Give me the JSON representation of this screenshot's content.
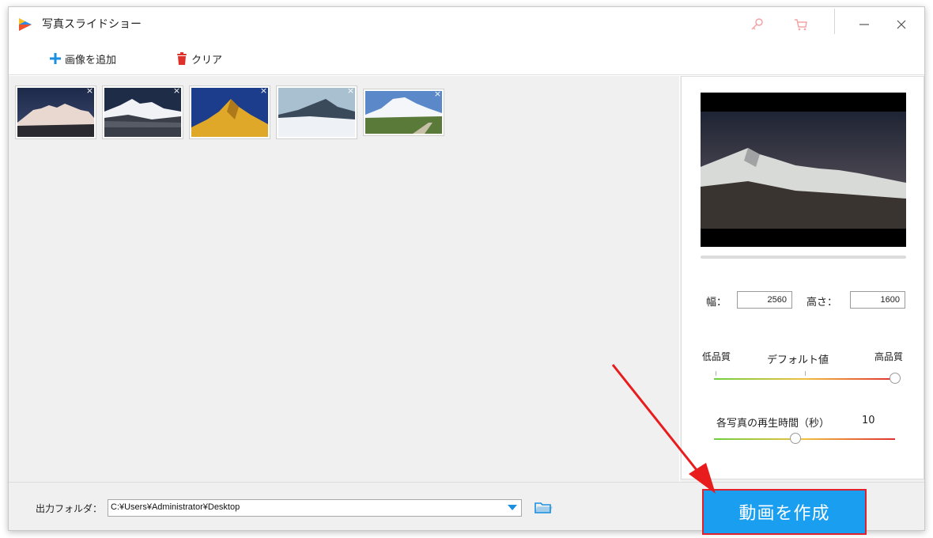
{
  "window": {
    "title": "写真スライドショー"
  },
  "titlebar": {
    "icons": [
      "key-icon",
      "cart-icon",
      "minimize-icon",
      "close-icon"
    ]
  },
  "toolbar": {
    "add_label": "画像を追加",
    "clear_label": "クリア"
  },
  "images": [
    {
      "name": "snowy-ridge-night",
      "close": "×"
    },
    {
      "name": "snow-peak-clouds",
      "close": "×"
    },
    {
      "name": "golden-peak",
      "close": "×"
    },
    {
      "name": "snow-valley",
      "close": "×"
    },
    {
      "name": "snow-mountain-road",
      "close": "×"
    }
  ],
  "settings": {
    "width_label": "幅：",
    "width_value": "2560",
    "height_label": "高さ：",
    "height_value": "1600",
    "quality_low": "低品質",
    "quality_default": "デフォルト値",
    "quality_high": "高品質",
    "quality_level": 1.0,
    "duration_label": "各写真の再生時間（秒）",
    "duration_value": "10",
    "duration_level": 0.45
  },
  "output": {
    "label": "出力フォルダ：",
    "path": "C:¥Users¥Administrator¥Desktop"
  },
  "create_button": "動画を作成",
  "colors": {
    "accent": "#1a9ff0",
    "add_icon": "#1a8fe0",
    "clear_icon": "#e0302a",
    "create_border": "#e0202a",
    "arrow": "#e81c1c"
  }
}
